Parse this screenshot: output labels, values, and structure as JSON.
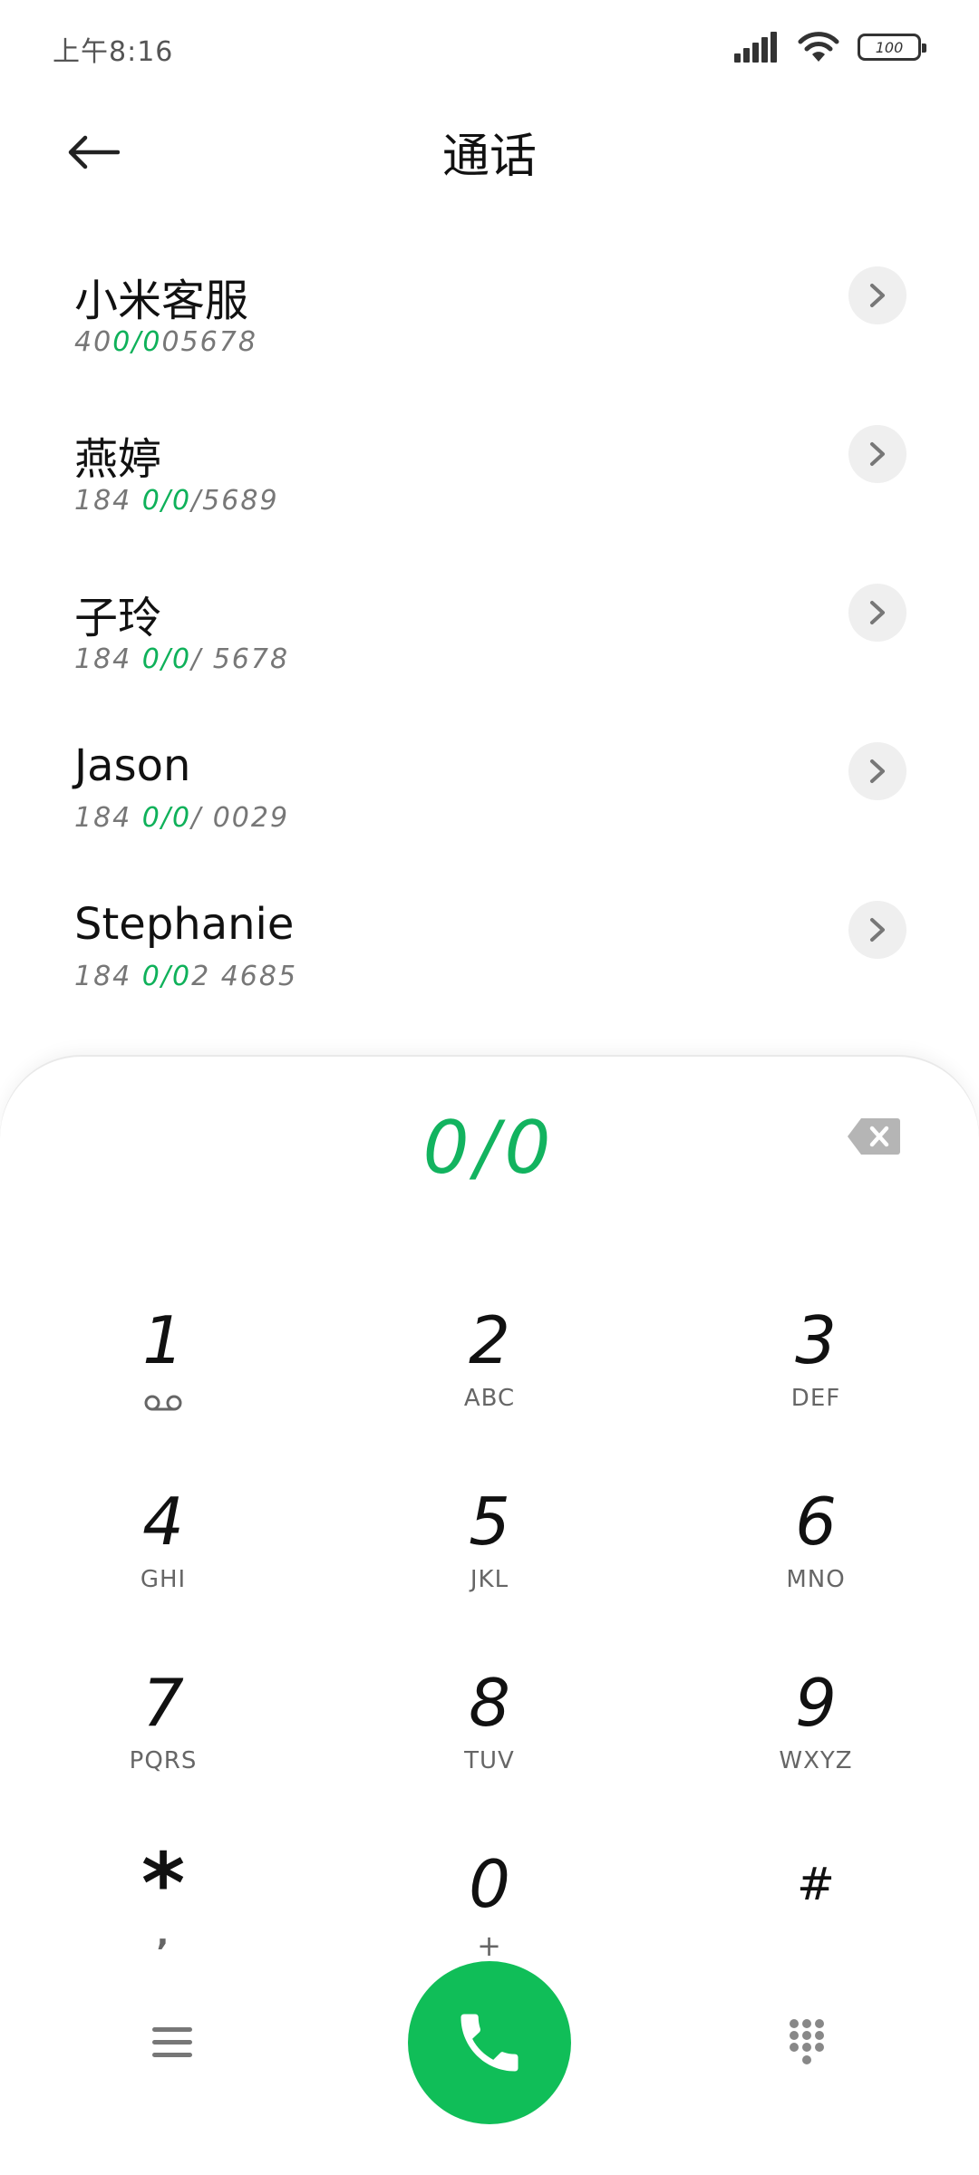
{
  "status_bar": {
    "time": "上午8:16",
    "battery_level": "100"
  },
  "header": {
    "title": "通话"
  },
  "contacts": [
    {
      "name": "小米客服",
      "number_prefix": "40",
      "number_match": "0/0",
      "number_suffix": "05678"
    },
    {
      "name": "燕婷",
      "number_prefix": "184 ",
      "number_match": "0/0",
      "number_suffix": "/5689"
    },
    {
      "name": "子玲",
      "number_prefix": "184 ",
      "number_match": "0/0",
      "number_suffix": "/ 5678"
    },
    {
      "name": "Jason",
      "number_prefix": "184 ",
      "number_match": "0/0",
      "number_suffix": "/ 0029"
    },
    {
      "name": "Stephanie",
      "number_prefix": "184 ",
      "number_match": "0/0",
      "number_suffix": "2 4685"
    }
  ],
  "dialer": {
    "entered_number": "0/0",
    "keys": [
      {
        "digit": "1",
        "letters": ""
      },
      {
        "digit": "2",
        "letters": "ABC"
      },
      {
        "digit": "3",
        "letters": "DEF"
      },
      {
        "digit": "4",
        "letters": "GHI"
      },
      {
        "digit": "5",
        "letters": "JKL"
      },
      {
        "digit": "6",
        "letters": "MNO"
      },
      {
        "digit": "7",
        "letters": "PQRS"
      },
      {
        "digit": "8",
        "letters": "TUV"
      },
      {
        "digit": "9",
        "letters": "WXYZ"
      },
      {
        "digit": "*",
        "letters": ","
      },
      {
        "digit": "0",
        "letters": "+"
      },
      {
        "digit": "#",
        "letters": ""
      }
    ]
  },
  "icons": {
    "back": "arrow-left-icon",
    "chevron": "chevron-right-icon",
    "backspace": "backspace-icon",
    "voicemail": "voicemail-icon",
    "menu": "menu-icon",
    "call": "phone-icon",
    "dialpad": "dialpad-icon"
  },
  "colors": {
    "accent": "#12b35f",
    "call_button": "#10be58"
  }
}
